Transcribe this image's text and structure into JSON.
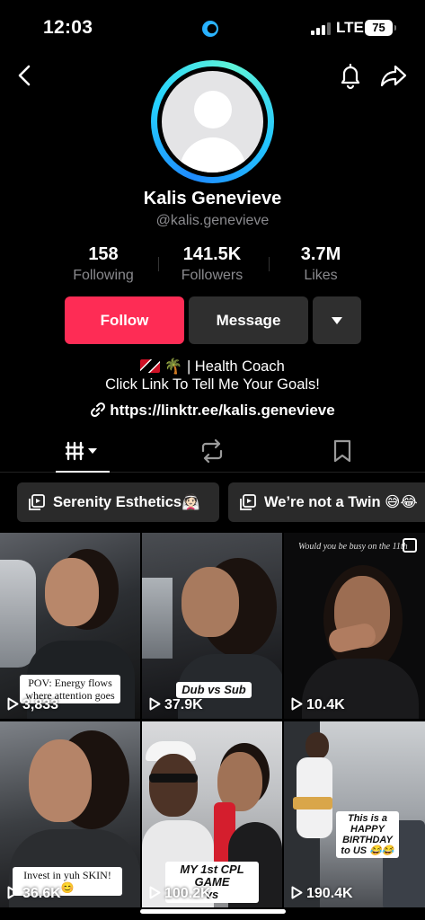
{
  "status": {
    "time": "12:03",
    "network": "LTE",
    "battery": "75"
  },
  "profile": {
    "name": "Kalis Genevieve",
    "handle": "@kalis.genevieve",
    "stats": [
      {
        "value": "158",
        "label": "Following"
      },
      {
        "value": "141.5K",
        "label": "Followers"
      },
      {
        "value": "3.7M",
        "label": "Likes"
      }
    ],
    "bio_line1_suffix": "| Health Coach",
    "bio_line2": "Click Link To Tell Me Your Goals!",
    "link": "https://linktr.ee/kalis.genevieve"
  },
  "actions": {
    "follow": "Follow",
    "message": "Message"
  },
  "playlists": [
    {
      "title": "Serenity Esthetics👰🏻"
    },
    {
      "title": "We’re not a Twin 😅😂"
    }
  ],
  "videos": [
    {
      "views": "3,833",
      "caption": "POV: Energy flows where attention goes"
    },
    {
      "views": "37.9K",
      "caption": "Dub vs Sub"
    },
    {
      "views": "10.4K",
      "caption": "Would you be busy on the 11th"
    },
    {
      "views": "36.6K",
      "caption": "Invest in yuh SKIN! 😊"
    },
    {
      "views": "100.2K",
      "caption": "MY 1st CPL GAME",
      "caption_line2": "vs"
    },
    {
      "views": "190.4K",
      "caption": "This is a HAPPY BIRTHDAY to US 😂😂"
    }
  ],
  "colors": {
    "follow": "#fe2c55",
    "ring_start": "#1f8bff",
    "ring_end": "#5ef3d8"
  }
}
